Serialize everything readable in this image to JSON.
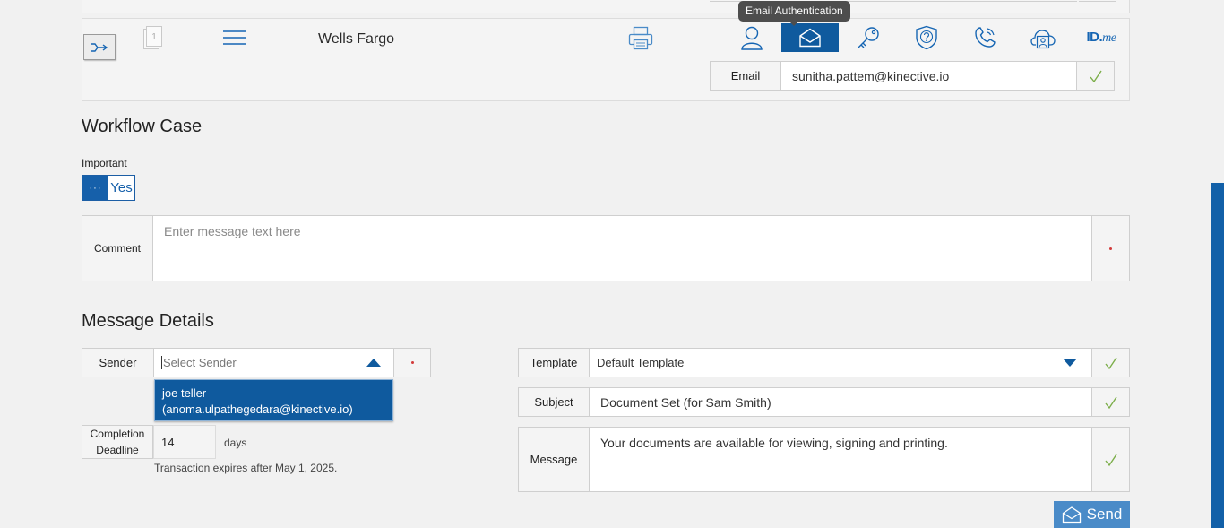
{
  "header": {
    "bank_name": "Wells Fargo",
    "doc_badge": "1",
    "tooltip": "Email Authentication",
    "auth_icons": [
      "person-icon",
      "email-icon",
      "key-icon",
      "shield-question-icon",
      "phone-icon",
      "cloud-person-icon",
      "idme-icon"
    ],
    "active_auth": "email-icon",
    "idme": {
      "main": "ID.",
      "accent": "me"
    },
    "email": {
      "label": "Email",
      "value": "sunitha.pattem@kinective.io"
    }
  },
  "workflow": {
    "title": "Workflow Case",
    "important_label": "Important",
    "toggle_knob": "···",
    "toggle_value": "Yes",
    "comment_label": "Comment",
    "comment_placeholder": "Enter message text here"
  },
  "message": {
    "title": "Message Details",
    "sender_label": "Sender",
    "sender_placeholder": "Select Sender",
    "sender_option_name": "joe teller",
    "sender_option_email": "(anoma.ulpathegedara@kinective.io)",
    "deadline_label_1": "Completion",
    "deadline_label_2": "Deadline",
    "deadline_value": "14",
    "days_label": "days",
    "expire_note": "Transaction expires after May 1, 2025.",
    "template_label": "Template",
    "template_value": "Default Template",
    "subject_label": "Subject",
    "subject_value": "Document Set (for Sam Smith)",
    "message_label": "Message",
    "message_value": "Your documents are available for viewing, signing and printing.",
    "send_label": "Send"
  },
  "colors": {
    "accent": "#0f5a9e",
    "check": "#7cae4a",
    "required": "#d23b3b"
  }
}
